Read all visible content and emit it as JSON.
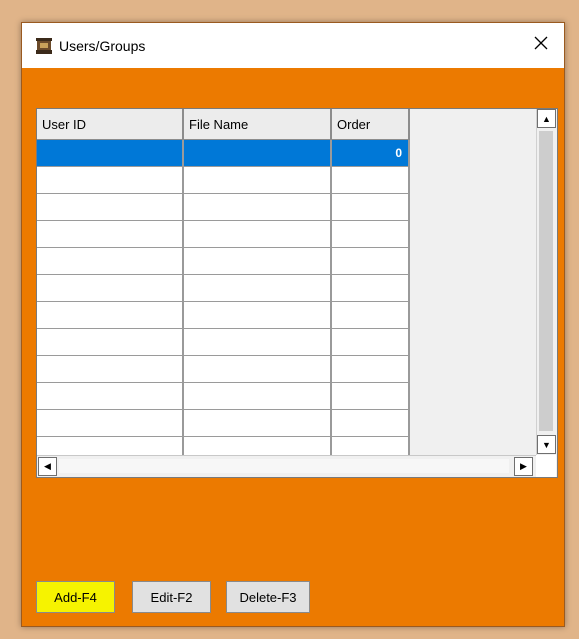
{
  "window": {
    "title": "Users/Groups",
    "app_icon": "stage-icon",
    "close_icon": "close-icon"
  },
  "grid": {
    "columns": [
      "User ID",
      "File Name",
      "Order"
    ],
    "rows": [
      {
        "user_id": "",
        "file_name": "",
        "order": "0",
        "selected": true
      },
      {
        "user_id": "",
        "file_name": "",
        "order": ""
      },
      {
        "user_id": "",
        "file_name": "",
        "order": ""
      },
      {
        "user_id": "",
        "file_name": "",
        "order": ""
      },
      {
        "user_id": "",
        "file_name": "",
        "order": ""
      },
      {
        "user_id": "",
        "file_name": "",
        "order": ""
      },
      {
        "user_id": "",
        "file_name": "",
        "order": ""
      },
      {
        "user_id": "",
        "file_name": "",
        "order": ""
      },
      {
        "user_id": "",
        "file_name": "",
        "order": ""
      },
      {
        "user_id": "",
        "file_name": "",
        "order": ""
      },
      {
        "user_id": "",
        "file_name": "",
        "order": ""
      },
      {
        "user_id": "",
        "file_name": "",
        "order": ""
      }
    ]
  },
  "buttons": {
    "add": "Add-F4",
    "edit": "Edit-F2",
    "delete": "Delete-F3"
  },
  "colors": {
    "window_bg": "#ec7a00",
    "selection": "#0078d7",
    "primary_button": "#f6f300",
    "desktop": "#e0b489"
  }
}
